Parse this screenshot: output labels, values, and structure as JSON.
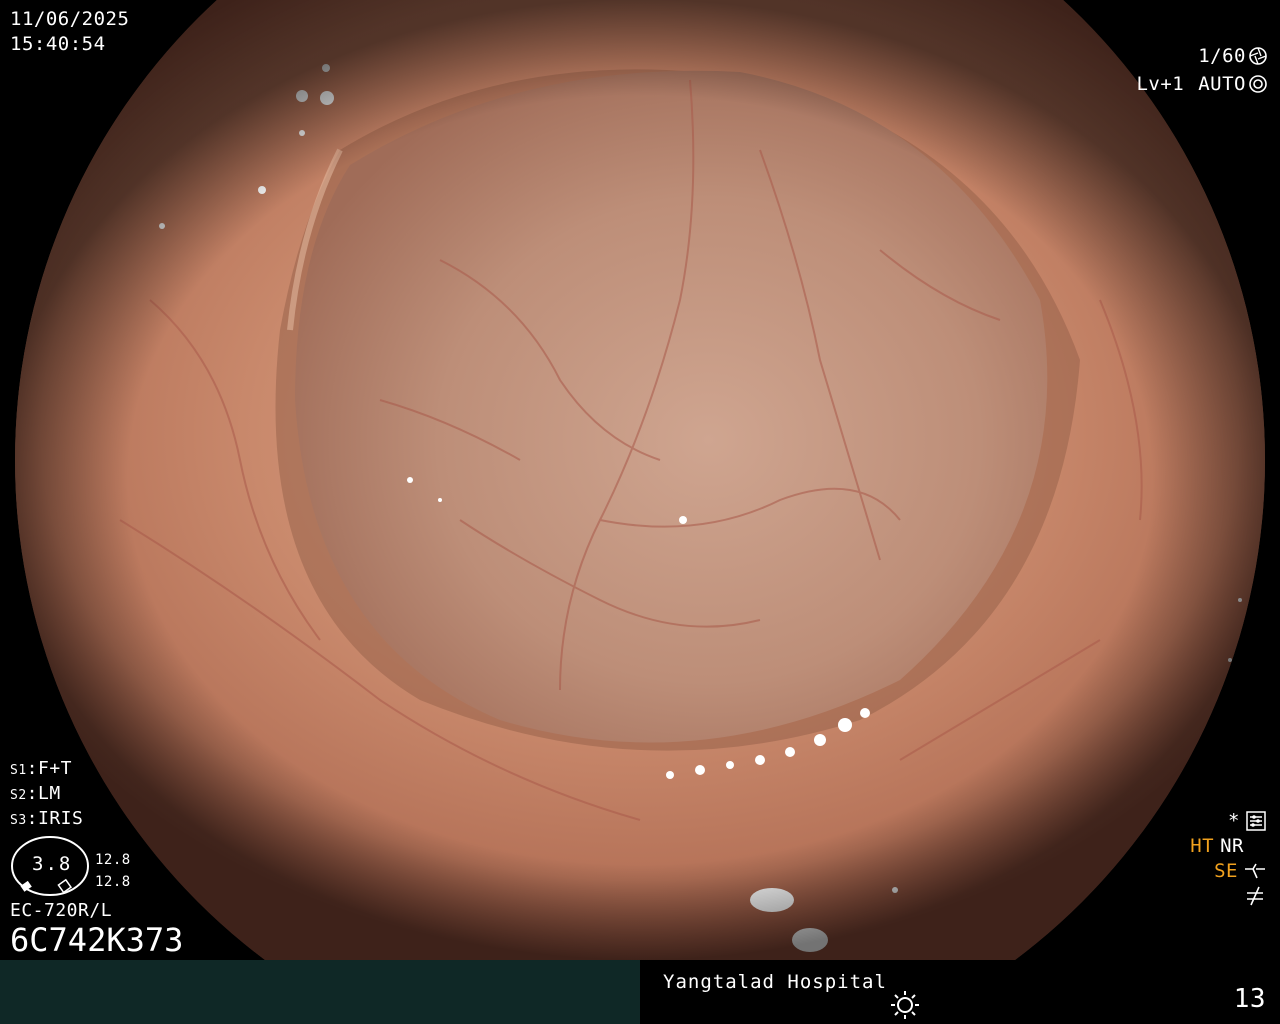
{
  "overlay": {
    "date": "11/06/2025",
    "time": "15:40:54",
    "shutter": "1/60",
    "shutter_icon": "shutter-icon",
    "level": "Lv+1",
    "mode": "AUTO",
    "mode_icon": "iris-icon"
  },
  "scope_settings": {
    "s1_prefix": "S1",
    "s1_value": "F+T",
    "s2_prefix": "S2",
    "s2_value": "LM",
    "s3_prefix": "S3",
    "s3_value": "IRIS",
    "gauge_value": "3.8",
    "gauge_top": "12.8",
    "gauge_bottom": "12.8",
    "model": "EC-720R/L",
    "serial": "6C742K373"
  },
  "right_indicators": {
    "star": "*",
    "star_icon": "settings-panel-icon",
    "ht": "HT",
    "nr": "NR",
    "se": "SE",
    "se_icon": "structure-enhance-icon",
    "freeze_icon": "freeze-off-icon"
  },
  "footer": {
    "hospital": "Yangtalad Hospital",
    "brightness_icon": "brightness-icon",
    "frame_number": "13"
  },
  "colors": {
    "mucosa": "#c88a70",
    "lumen": "#b98a72",
    "bar_left": "#0f2826",
    "accent_orange": "#f2a21e"
  }
}
